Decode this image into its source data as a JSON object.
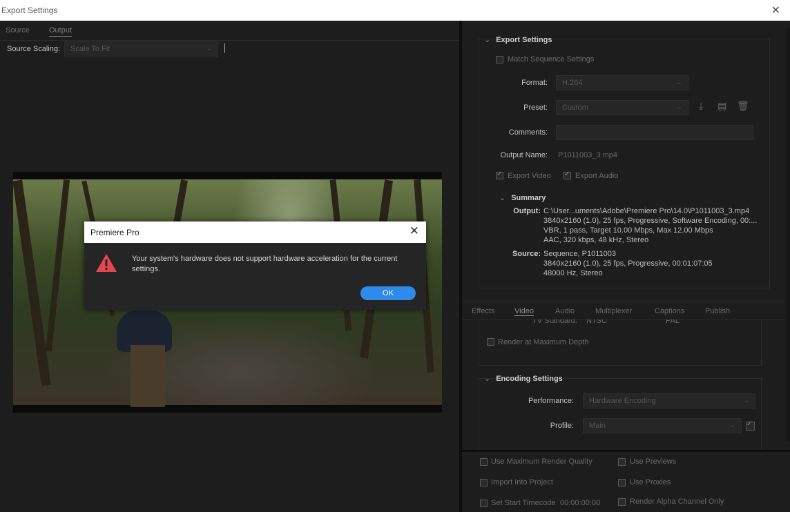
{
  "window": {
    "title": "Export Settings",
    "close_icon": "close-icon"
  },
  "left_tabs": [
    {
      "label": "Source"
    },
    {
      "label": "Output"
    }
  ],
  "source_scaling": {
    "label": "Source Scaling:",
    "value": "Scale To Fit"
  },
  "dialog": {
    "title": "Premiere Pro",
    "message": "Your system's hardware does not support hardware acceleration for the current settings.",
    "ok": "OK",
    "warning_color": "#e34850",
    "ok_color": "#2d8ceb"
  },
  "export_settings": {
    "heading": "Export Settings",
    "match_sequence": "Match Sequence Settings",
    "format_label": "Format:",
    "format_value": "H.264",
    "preset_label": "Preset:",
    "preset_value": "Custom",
    "comments_label": "Comments:",
    "output_name_label": "Output Name:",
    "output_name_value": "P1011003_3.mp4",
    "export_video": "Export Video",
    "export_audio": "Export Audio"
  },
  "summary": {
    "heading": "Summary",
    "output_key": "Output:",
    "output_lines": [
      "C:\\User...uments\\Adobe\\Premiere Pro\\14.0\\P1011003_3.mp4",
      "3840x2160 (1.0), 25 fps, Progressive, Software Encoding, 00:...",
      "VBR, 1 pass, Target 10.00 Mbps, Max 12.00 Mbps",
      "AAC, 320 kbps, 48 kHz, Stereo"
    ],
    "source_key": "Source:",
    "source_lines": [
      "Sequence, P1011003",
      "3840x2160 (1.0), 25 fps, Progressive, 00:01:07:05",
      "48000 Hz, Stereo"
    ]
  },
  "settings_tabs": [
    {
      "label": "Effects"
    },
    {
      "label": "Video"
    },
    {
      "label": "Audio"
    },
    {
      "label": "Multiplexer"
    },
    {
      "label": "Captions"
    },
    {
      "label": "Publish"
    }
  ],
  "video": {
    "tv_standard": "TV Standard:",
    "ntsc": "NTSC",
    "pal": "PAL",
    "render_max_depth": "Render at Maximum Depth"
  },
  "encoding": {
    "heading": "Encoding Settings",
    "performance_label": "Performance:",
    "performance_value": "Hardware Encoding",
    "profile_label": "Profile:",
    "profile_value": "Main"
  },
  "bottom": {
    "use_max_render_quality": "Use Maximum Render Quality",
    "use_previews": "Use Previews",
    "import_into_project": "Import Into Project",
    "use_proxies": "Use Proxies",
    "set_start_timecode": "Set Start Timecode",
    "start_timecode_value": "00:00:00:00",
    "render_alpha": "Render Alpha Channel Only"
  }
}
